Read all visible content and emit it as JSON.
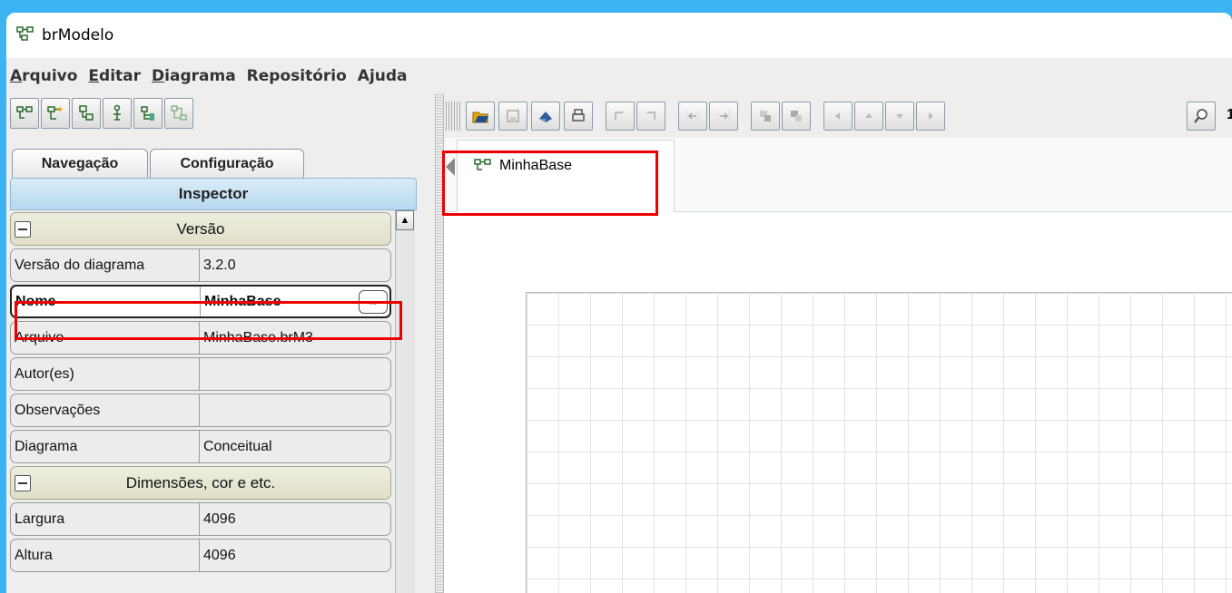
{
  "app": {
    "title": "brModelo"
  },
  "menu": [
    {
      "mnemonic": "A",
      "rest": "rquivo"
    },
    {
      "mnemonic": "E",
      "rest": "ditar"
    },
    {
      "mnemonic": "D",
      "rest": "iagrama"
    },
    {
      "mnemonic": "",
      "rest": "Repositório"
    },
    {
      "mnemonic": "",
      "rest": "Ajuda"
    }
  ],
  "left_toolbar_icons": [
    "new-diagram-icon",
    "conceptual-icon",
    "logical-icon",
    "entity-icon",
    "tree-icon",
    "model-icon"
  ],
  "tabs": {
    "navigation": "Navegação",
    "configuration": "Configuração"
  },
  "inspector": {
    "title": "Inspector",
    "sections": {
      "version": "Versão",
      "dimensions": "Dimensões, cor e etc."
    },
    "rows": {
      "diagram_version": {
        "key": "Versão do diagrama",
        "value": "3.2.0"
      },
      "name": {
        "key": "Nome",
        "value": "MinhaBase"
      },
      "file": {
        "key": "Arquivo",
        "value": "MinhaBase.brM3"
      },
      "authors": {
        "key": "Autor(es)",
        "value": ""
      },
      "notes": {
        "key": "Observações",
        "value": ""
      },
      "diagram": {
        "key": "Diagrama",
        "value": "Conceitual"
      },
      "width": {
        "key": "Largura",
        "value": "4096"
      },
      "height": {
        "key": "Altura",
        "value": "4096"
      }
    },
    "ellipsis": "..."
  },
  "doc_tab": {
    "label": "MinhaBase"
  },
  "zoom_text": "1",
  "colors": {
    "background": "#3cb4f4",
    "highlight": "#ee0000"
  }
}
